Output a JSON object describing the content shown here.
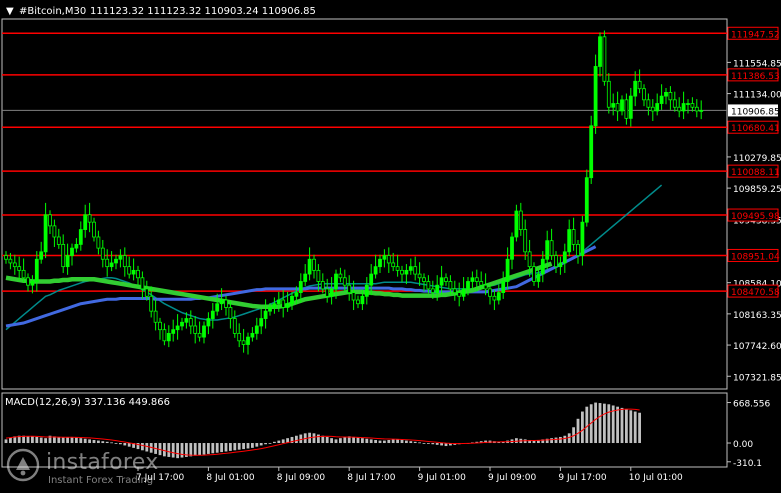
{
  "header": {
    "symbol_label": "#Bitcoin,M30",
    "ohlc_values": "111123.32 111123.32 110903.24 110906.85"
  },
  "macd": {
    "label": "MACD(12,26,9) 337.136 449.866",
    "scale_labels": [
      "668.556",
      "0.00",
      "-310.1"
    ]
  },
  "watermark": {
    "brand": "instaforex",
    "tagline": "Instant Forex Trading"
  },
  "colors": {
    "background": "#000000",
    "bull_candle": "#00ff00",
    "bear_candle": "#000000",
    "candle_outline": "#00ff00",
    "level_line": "#ff0000",
    "ma_fast": "#008b8b",
    "ma_mid": "#4169e1",
    "ma_slow": "#32cd32",
    "macd_hist": "#c0c0c0",
    "macd_signal": "#ff0000",
    "axis_text": "#ffffff"
  },
  "chart_data": {
    "type": "candlestick",
    "symbol": "#Bitcoin",
    "timeframe": "M30",
    "ylim": [
      107150,
      112140
    ],
    "price_ticks": [
      111554.85,
      111134.0,
      110279.85,
      109859.25,
      109438.35,
      108584.1,
      108163.35,
      107742.6,
      107321.85
    ],
    "current_price": {
      "label": "110906.85",
      "value": 110906.85
    },
    "horizontal_levels": [
      {
        "label": "111947.52",
        "value": 111947.52
      },
      {
        "label": "111386.53",
        "value": 111386.53
      },
      {
        "label": "110680.41",
        "value": 110680.41
      },
      {
        "label": "110088.11",
        "value": 110088.11
      },
      {
        "label": "109495.98",
        "value": 109495.98
      },
      {
        "label": "108951.04",
        "value": 108951.04
      },
      {
        "label": "108470.58",
        "value": 108470.58
      }
    ],
    "time_labels": [
      {
        "label": "7 Jul 17:00",
        "index": 30
      },
      {
        "label": "8 Jul 01:00",
        "index": 46
      },
      {
        "label": "8 Jul 09:00",
        "index": 62
      },
      {
        "label": "8 Jul 17:00",
        "index": 78
      },
      {
        "label": "9 Jul 01:00",
        "index": 94
      },
      {
        "label": "9 Jul 09:00",
        "index": 110
      },
      {
        "label": "9 Jul 17:00",
        "index": 126
      },
      {
        "label": "10 Jul 01:00",
        "index": 142
      }
    ],
    "closes": [
      108900,
      108850,
      108800,
      108750,
      108650,
      108550,
      108600,
      108900,
      109000,
      109500,
      109350,
      109200,
      109100,
      108800,
      108950,
      109050,
      109100,
      109300,
      109500,
      109400,
      109200,
      109050,
      108900,
      108800,
      108850,
      108900,
      108950,
      108800,
      108700,
      108750,
      108650,
      108500,
      108400,
      108200,
      108050,
      107950,
      107800,
      107900,
      107950,
      108000,
      108050,
      108100,
      108000,
      107900,
      107850,
      108000,
      108100,
      108200,
      108300,
      108350,
      108250,
      108100,
      107900,
      107800,
      107750,
      107850,
      107900,
      108000,
      108100,
      108200,
      108250,
      108300,
      108350,
      108250,
      108300,
      108400,
      108450,
      108600,
      108700,
      108900,
      108750,
      108600,
      108500,
      108400,
      108500,
      108700,
      108650,
      108550,
      108450,
      108350,
      108300,
      108400,
      108550,
      108700,
      108800,
      108900,
      108950,
      108850,
      108800,
      108750,
      108700,
      108750,
      108800,
      108700,
      108650,
      108600,
      108500,
      108450,
      108550,
      108650,
      108600,
      108500,
      108450,
      108400,
      108500,
      108600,
      108650,
      108600,
      108550,
      108500,
      108400,
      108350,
      108450,
      108600,
      108900,
      109200,
      109550,
      109300,
      109000,
      108800,
      108600,
      108700,
      108900,
      109150,
      108950,
      108800,
      108850,
      109000,
      109300,
      109100,
      108950,
      109400,
      110000,
      110700,
      111500,
      111900,
      111300,
      110950,
      111000,
      110900,
      111050,
      110800,
      111100,
      111300,
      111200,
      111050,
      110950,
      110900,
      111000,
      111100,
      111150,
      111050,
      110950,
      110900,
      111000,
      111000,
      110950,
      110900,
      110906.85
    ],
    "ma_fast": [
      107950,
      108000,
      108050,
      108100,
      108150,
      108200,
      108250,
      108300,
      108350,
      108400,
      108420,
      108450,
      108480,
      108500,
      108520,
      108540,
      108560,
      108580,
      108600,
      108610,
      108620,
      108630,
      108640,
      108650,
      108650,
      108640,
      108620,
      108600,
      108580,
      108550,
      108520,
      108490,
      108460,
      108420,
      108380,
      108340,
      108300,
      108270,
      108240,
      108210,
      108180,
      108160,
      108140,
      108120,
      108100,
      108090,
      108080,
      108080,
      108080,
      108090,
      108100,
      108110,
      108120,
      108140,
      108160,
      108180,
      108200,
      108220,
      108240,
      108260,
      108290,
      108320,
      108350,
      108380,
      108410,
      108440,
      108470,
      108500,
      108520,
      108540,
      108550,
      108560,
      108570,
      108570,
      108570,
      108570,
      108570,
      108570,
      108570,
      108570,
      108570,
      108570,
      108570,
      108570,
      108570,
      108580,
      108590,
      108590,
      108590,
      108590,
      108590,
      108590,
      108590,
      108580,
      108570,
      108560,
      108550,
      108540,
      108530,
      108520,
      108510,
      108500,
      108500,
      108500,
      108500,
      108500,
      108500,
      108510,
      108520,
      108530,
      108540,
      108550,
      108570,
      108590,
      108610,
      108630,
      108650,
      108670,
      108690,
      108700,
      108710,
      108720,
      108740,
      108760,
      108780,
      108800,
      108820,
      108850,
      108880,
      108910,
      108950,
      109000,
      109050,
      109100,
      109150,
      109200,
      109250,
      109300,
      109350,
      109400,
      109450,
      109500,
      109550,
      109600,
      109650,
      109700,
      109750,
      109800,
      109850,
      109900
    ],
    "ma_mid": [
      108000,
      108010,
      108020,
      108030,
      108040,
      108060,
      108080,
      108100,
      108120,
      108140,
      108160,
      108180,
      108200,
      108220,
      108240,
      108260,
      108280,
      108300,
      108310,
      108320,
      108330,
      108340,
      108350,
      108360,
      108360,
      108360,
      108370,
      108370,
      108370,
      108370,
      108370,
      108370,
      108370,
      108370,
      108360,
      108360,
      108360,
      108360,
      108360,
      108360,
      108360,
      108360,
      108360,
      108370,
      108370,
      108380,
      108380,
      108390,
      108400,
      108410,
      108420,
      108430,
      108440,
      108450,
      108460,
      108470,
      108480,
      108490,
      108490,
      108500,
      108500,
      108500,
      108500,
      108500,
      108500,
      108500,
      108500,
      108500,
      108500,
      108510,
      108510,
      108510,
      108510,
      108510,
      108510,
      108510,
      108510,
      108510,
      108510,
      108510,
      108510,
      108510,
      108510,
      108510,
      108510,
      108510,
      108510,
      108510,
      108500,
      108500,
      108500,
      108490,
      108490,
      108480,
      108480,
      108470,
      108470,
      108460,
      108460,
      108460,
      108460,
      108460,
      108460,
      108460,
      108460,
      108460,
      108460,
      108460,
      108460,
      108460,
      108470,
      108480,
      108490,
      108500,
      108510,
      108520,
      108530,
      108560,
      108590,
      108620,
      108650,
      108680,
      108710,
      108740,
      108770,
      108800,
      108830,
      108860,
      108890,
      108920,
      108950,
      108980,
      109010,
      109040,
      109070
    ],
    "ma_slow": [
      108650,
      108640,
      108630,
      108620,
      108610,
      108610,
      108600,
      108600,
      108600,
      108600,
      108600,
      108610,
      108610,
      108620,
      108620,
      108630,
      108630,
      108630,
      108630,
      108630,
      108630,
      108620,
      108610,
      108600,
      108590,
      108580,
      108570,
      108560,
      108550,
      108540,
      108530,
      108520,
      108510,
      108500,
      108490,
      108480,
      108470,
      108460,
      108450,
      108440,
      108430,
      108420,
      108410,
      108400,
      108390,
      108380,
      108370,
      108360,
      108350,
      108340,
      108330,
      108320,
      108310,
      108300,
      108290,
      108280,
      108270,
      108265,
      108260,
      108260,
      108260,
      108260,
      108260,
      108270,
      108280,
      108300,
      108320,
      108340,
      108360,
      108370,
      108380,
      108390,
      108400,
      108410,
      108420,
      108430,
      108440,
      108450,
      108460,
      108460,
      108460,
      108460,
      108450,
      108450,
      108440,
      108440,
      108430,
      108430,
      108420,
      108420,
      108410,
      108410,
      108410,
      108410,
      108410,
      108410,
      108410,
      108410,
      108410,
      108420,
      108420,
      108430,
      108440,
      108450,
      108460,
      108470,
      108480,
      108500,
      108520,
      108540,
      108560,
      108580,
      108600,
      108620,
      108640,
      108660,
      108680,
      108700,
      108720,
      108740,
      108760,
      108780,
      108800,
      108820,
      108840
    ],
    "macd_hist": [
      60,
      90,
      110,
      120,
      120,
      115,
      110,
      100,
      90,
      80,
      120,
      110,
      100,
      90,
      95,
      100,
      90,
      80,
      70,
      60,
      50,
      40,
      30,
      20,
      10,
      0,
      -20,
      -40,
      -60,
      -80,
      -100,
      -120,
      -140,
      -160,
      -180,
      -200,
      -220,
      -230,
      -240,
      -250,
      -240,
      -230,
      -220,
      -210,
      -200,
      -190,
      -180,
      -170,
      -160,
      -150,
      -140,
      -130,
      -120,
      -110,
      -100,
      -90,
      -80,
      -60,
      -40,
      -20,
      0,
      20,
      40,
      60,
      80,
      100,
      120,
      140,
      160,
      170,
      160,
      140,
      120,
      100,
      80,
      60,
      80,
      100,
      110,
      100,
      90,
      80,
      70,
      60,
      50,
      40,
      40,
      50,
      60,
      60,
      50,
      40,
      30,
      20,
      10,
      0,
      -10,
      -20,
      -30,
      -40,
      -50,
      -40,
      -30,
      -20,
      -10,
      0,
      10,
      20,
      30,
      40,
      40,
      30,
      20,
      20,
      40,
      60,
      80,
      70,
      60,
      50,
      40,
      50,
      60,
      70,
      80,
      90,
      100,
      120,
      160,
      260,
      400,
      520,
      600,
      640,
      668,
      660,
      650,
      640,
      620,
      600,
      580,
      560,
      540,
      520,
      500
    ],
    "macd_signal": [
      80,
      90,
      100,
      105,
      110,
      112,
      112,
      110,
      105,
      100,
      100,
      100,
      98,
      96,
      95,
      95,
      94,
      92,
      88,
      84,
      79,
      73,
      66,
      58,
      49,
      39,
      28,
      16,
      3,
      -10,
      -25,
      -40,
      -56,
      -72,
      -90,
      -108,
      -126,
      -144,
      -160,
      -176,
      -188,
      -196,
      -200,
      -202,
      -202,
      -200,
      -196,
      -191,
      -185,
      -178,
      -170,
      -162,
      -153,
      -144,
      -135,
      -126,
      -116,
      -105,
      -92,
      -78,
      -62,
      -45,
      -28,
      -11,
      6,
      23,
      40,
      57,
      73,
      87,
      98,
      106,
      110,
      112,
      110,
      104,
      100,
      99,
      98,
      97,
      94,
      90,
      86,
      82,
      77,
      72,
      68,
      66,
      64,
      62,
      59,
      55,
      50,
      45,
      39,
      33,
      26,
      19,
      12,
      5,
      -2,
      -6,
      -8,
      -9,
      -8,
      -6,
      -3,
      1,
      5,
      10,
      14,
      17,
      19,
      20,
      21,
      25,
      30,
      35,
      38,
      40,
      42,
      44,
      47,
      51,
      55,
      60,
      66,
      75,
      92,
      120,
      160,
      210,
      270,
      330,
      390,
      440,
      480,
      510,
      530,
      545,
      555,
      560,
      560,
      555,
      545
    ]
  }
}
